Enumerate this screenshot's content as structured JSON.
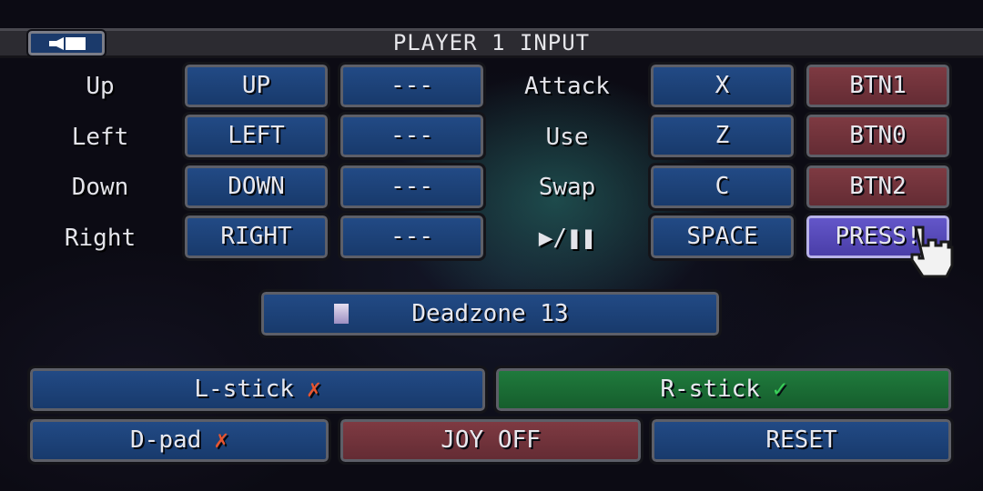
{
  "header": {
    "title": "PLAYER 1 INPUT",
    "back_icon": "speaker-back-icon"
  },
  "directions": [
    {
      "label": "Up",
      "primary": "UP",
      "secondary": "---"
    },
    {
      "label": "Left",
      "primary": "LEFT",
      "secondary": "---"
    },
    {
      "label": "Down",
      "primary": "DOWN",
      "secondary": "---"
    },
    {
      "label": "Right",
      "primary": "RIGHT",
      "secondary": "---"
    }
  ],
  "actions": [
    {
      "label": "Attack",
      "key": "X",
      "joy": "BTN1"
    },
    {
      "label": "Use",
      "key": "Z",
      "joy": "BTN0"
    },
    {
      "label": "Swap",
      "key": "C",
      "joy": "BTN2"
    },
    {
      "label": "▶/❚❚",
      "key": "SPACE",
      "joy": "PRESS!"
    }
  ],
  "deadzone": {
    "label": "Deadzone 13",
    "value": 13
  },
  "toggles": {
    "lstick": {
      "label": "L-stick",
      "mark": "✗"
    },
    "rstick": {
      "label": "R-stick",
      "mark": "✓"
    },
    "dpad": {
      "label": "D-pad",
      "mark": "✗"
    }
  },
  "buttons": {
    "joy_off": "JOY OFF",
    "reset": "RESET"
  },
  "colors": {
    "button_blue": "#1b3a6b",
    "button_red": "#6c3038",
    "button_green": "#1a6a34",
    "button_active": "#5a4fbf"
  }
}
